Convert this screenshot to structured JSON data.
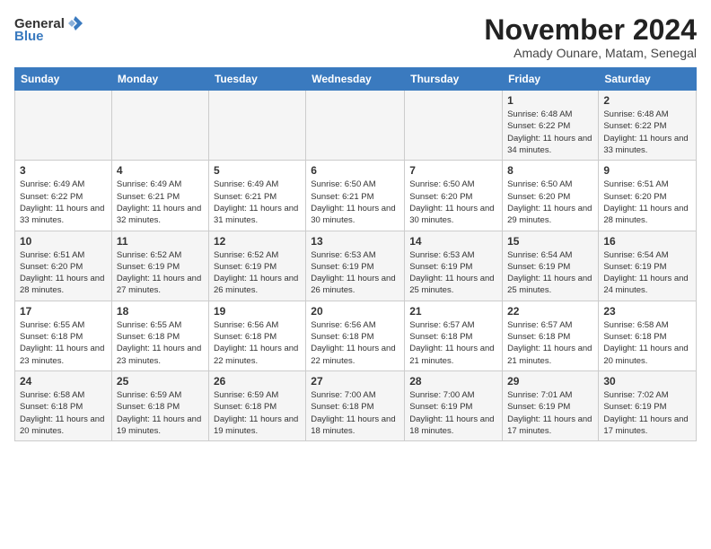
{
  "header": {
    "logo_general": "General",
    "logo_blue": "Blue",
    "month_title": "November 2024",
    "subtitle": "Amady Ounare, Matam, Senegal"
  },
  "weekdays": [
    "Sunday",
    "Monday",
    "Tuesday",
    "Wednesday",
    "Thursday",
    "Friday",
    "Saturday"
  ],
  "weeks": [
    [
      {
        "day": "",
        "sunrise": "",
        "sunset": "",
        "daylight": ""
      },
      {
        "day": "",
        "sunrise": "",
        "sunset": "",
        "daylight": ""
      },
      {
        "day": "",
        "sunrise": "",
        "sunset": "",
        "daylight": ""
      },
      {
        "day": "",
        "sunrise": "",
        "sunset": "",
        "daylight": ""
      },
      {
        "day": "",
        "sunrise": "",
        "sunset": "",
        "daylight": ""
      },
      {
        "day": "1",
        "sunrise": "Sunrise: 6:48 AM",
        "sunset": "Sunset: 6:22 PM",
        "daylight": "Daylight: 11 hours and 34 minutes."
      },
      {
        "day": "2",
        "sunrise": "Sunrise: 6:48 AM",
        "sunset": "Sunset: 6:22 PM",
        "daylight": "Daylight: 11 hours and 33 minutes."
      }
    ],
    [
      {
        "day": "3",
        "sunrise": "Sunrise: 6:49 AM",
        "sunset": "Sunset: 6:22 PM",
        "daylight": "Daylight: 11 hours and 33 minutes."
      },
      {
        "day": "4",
        "sunrise": "Sunrise: 6:49 AM",
        "sunset": "Sunset: 6:21 PM",
        "daylight": "Daylight: 11 hours and 32 minutes."
      },
      {
        "day": "5",
        "sunrise": "Sunrise: 6:49 AM",
        "sunset": "Sunset: 6:21 PM",
        "daylight": "Daylight: 11 hours and 31 minutes."
      },
      {
        "day": "6",
        "sunrise": "Sunrise: 6:50 AM",
        "sunset": "Sunset: 6:21 PM",
        "daylight": "Daylight: 11 hours and 30 minutes."
      },
      {
        "day": "7",
        "sunrise": "Sunrise: 6:50 AM",
        "sunset": "Sunset: 6:20 PM",
        "daylight": "Daylight: 11 hours and 30 minutes."
      },
      {
        "day": "8",
        "sunrise": "Sunrise: 6:50 AM",
        "sunset": "Sunset: 6:20 PM",
        "daylight": "Daylight: 11 hours and 29 minutes."
      },
      {
        "day": "9",
        "sunrise": "Sunrise: 6:51 AM",
        "sunset": "Sunset: 6:20 PM",
        "daylight": "Daylight: 11 hours and 28 minutes."
      }
    ],
    [
      {
        "day": "10",
        "sunrise": "Sunrise: 6:51 AM",
        "sunset": "Sunset: 6:20 PM",
        "daylight": "Daylight: 11 hours and 28 minutes."
      },
      {
        "day": "11",
        "sunrise": "Sunrise: 6:52 AM",
        "sunset": "Sunset: 6:19 PM",
        "daylight": "Daylight: 11 hours and 27 minutes."
      },
      {
        "day": "12",
        "sunrise": "Sunrise: 6:52 AM",
        "sunset": "Sunset: 6:19 PM",
        "daylight": "Daylight: 11 hours and 26 minutes."
      },
      {
        "day": "13",
        "sunrise": "Sunrise: 6:53 AM",
        "sunset": "Sunset: 6:19 PM",
        "daylight": "Daylight: 11 hours and 26 minutes."
      },
      {
        "day": "14",
        "sunrise": "Sunrise: 6:53 AM",
        "sunset": "Sunset: 6:19 PM",
        "daylight": "Daylight: 11 hours and 25 minutes."
      },
      {
        "day": "15",
        "sunrise": "Sunrise: 6:54 AM",
        "sunset": "Sunset: 6:19 PM",
        "daylight": "Daylight: 11 hours and 25 minutes."
      },
      {
        "day": "16",
        "sunrise": "Sunrise: 6:54 AM",
        "sunset": "Sunset: 6:19 PM",
        "daylight": "Daylight: 11 hours and 24 minutes."
      }
    ],
    [
      {
        "day": "17",
        "sunrise": "Sunrise: 6:55 AM",
        "sunset": "Sunset: 6:18 PM",
        "daylight": "Daylight: 11 hours and 23 minutes."
      },
      {
        "day": "18",
        "sunrise": "Sunrise: 6:55 AM",
        "sunset": "Sunset: 6:18 PM",
        "daylight": "Daylight: 11 hours and 23 minutes."
      },
      {
        "day": "19",
        "sunrise": "Sunrise: 6:56 AM",
        "sunset": "Sunset: 6:18 PM",
        "daylight": "Daylight: 11 hours and 22 minutes."
      },
      {
        "day": "20",
        "sunrise": "Sunrise: 6:56 AM",
        "sunset": "Sunset: 6:18 PM",
        "daylight": "Daylight: 11 hours and 22 minutes."
      },
      {
        "day": "21",
        "sunrise": "Sunrise: 6:57 AM",
        "sunset": "Sunset: 6:18 PM",
        "daylight": "Daylight: 11 hours and 21 minutes."
      },
      {
        "day": "22",
        "sunrise": "Sunrise: 6:57 AM",
        "sunset": "Sunset: 6:18 PM",
        "daylight": "Daylight: 11 hours and 21 minutes."
      },
      {
        "day": "23",
        "sunrise": "Sunrise: 6:58 AM",
        "sunset": "Sunset: 6:18 PM",
        "daylight": "Daylight: 11 hours and 20 minutes."
      }
    ],
    [
      {
        "day": "24",
        "sunrise": "Sunrise: 6:58 AM",
        "sunset": "Sunset: 6:18 PM",
        "daylight": "Daylight: 11 hours and 20 minutes."
      },
      {
        "day": "25",
        "sunrise": "Sunrise: 6:59 AM",
        "sunset": "Sunset: 6:18 PM",
        "daylight": "Daylight: 11 hours and 19 minutes."
      },
      {
        "day": "26",
        "sunrise": "Sunrise: 6:59 AM",
        "sunset": "Sunset: 6:18 PM",
        "daylight": "Daylight: 11 hours and 19 minutes."
      },
      {
        "day": "27",
        "sunrise": "Sunrise: 7:00 AM",
        "sunset": "Sunset: 6:18 PM",
        "daylight": "Daylight: 11 hours and 18 minutes."
      },
      {
        "day": "28",
        "sunrise": "Sunrise: 7:00 AM",
        "sunset": "Sunset: 6:19 PM",
        "daylight": "Daylight: 11 hours and 18 minutes."
      },
      {
        "day": "29",
        "sunrise": "Sunrise: 7:01 AM",
        "sunset": "Sunset: 6:19 PM",
        "daylight": "Daylight: 11 hours and 17 minutes."
      },
      {
        "day": "30",
        "sunrise": "Sunrise: 7:02 AM",
        "sunset": "Sunset: 6:19 PM",
        "daylight": "Daylight: 11 hours and 17 minutes."
      }
    ]
  ]
}
